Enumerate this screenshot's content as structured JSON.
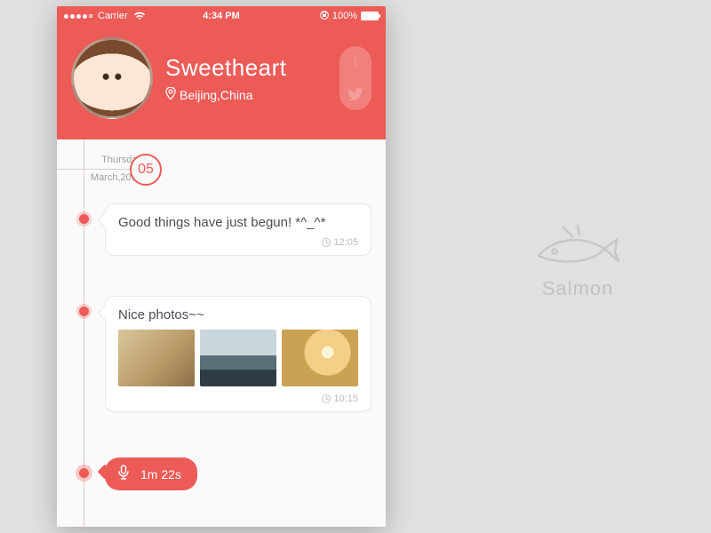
{
  "statusbar": {
    "carrier": "Carrier",
    "time": "4:34 PM",
    "battery_pct": "100%"
  },
  "profile": {
    "name": "Sweetheart",
    "location": "Beijing,China"
  },
  "social": {
    "facebook_glyph": "f",
    "twitter_name": "twitter-icon"
  },
  "date": {
    "weekday": "Thursday",
    "month_year": "March,2014",
    "day_number": "05"
  },
  "posts": [
    {
      "text": "Good things have just begun!  *^_^*",
      "time": "12:05"
    },
    {
      "text": "Nice photos~~",
      "time": "10:15",
      "photo_count": 3
    }
  ],
  "voice": {
    "duration": "1m 22s"
  },
  "brand": {
    "name": "Salmon"
  },
  "colors": {
    "accent": "#ed5b57",
    "canvas": "#e0e0e0"
  }
}
